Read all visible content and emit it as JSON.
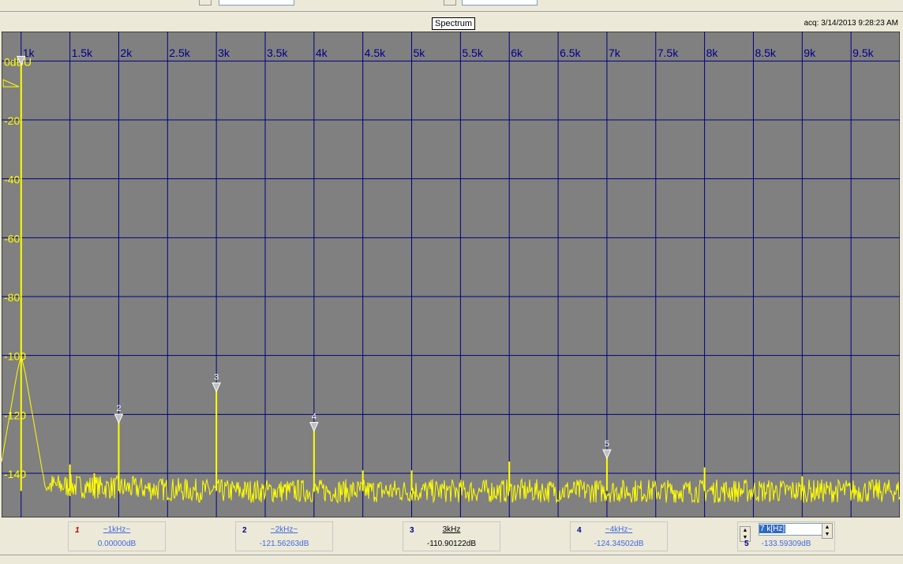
{
  "header": {
    "title": "Spectrum",
    "acq": "acq: 3/14/2013 9:28:23 AM"
  },
  "chart_data": {
    "type": "line",
    "title": "Spectrum",
    "xlabel": "",
    "ylabel": "",
    "xlim": [
      800,
      10000
    ],
    "ylim": [
      -155,
      10
    ],
    "x_ticks": [
      {
        "value": 1000,
        "label": "1k"
      },
      {
        "value": 1500,
        "label": "1.5k"
      },
      {
        "value": 2000,
        "label": "2k"
      },
      {
        "value": 2500,
        "label": "2.5k"
      },
      {
        "value": 3000,
        "label": "3k"
      },
      {
        "value": 3500,
        "label": "3.5k"
      },
      {
        "value": 4000,
        "label": "4k"
      },
      {
        "value": 4500,
        "label": "4.5k"
      },
      {
        "value": 5000,
        "label": "5k"
      },
      {
        "value": 5500,
        "label": "5.5k"
      },
      {
        "value": 6000,
        "label": "6k"
      },
      {
        "value": 6500,
        "label": "6.5k"
      },
      {
        "value": 7000,
        "label": "7k"
      },
      {
        "value": 7500,
        "label": "7.5k"
      },
      {
        "value": 8000,
        "label": "8k"
      },
      {
        "value": 8500,
        "label": "8.5k"
      },
      {
        "value": 9000,
        "label": "9k"
      },
      {
        "value": 9500,
        "label": "9.5k"
      }
    ],
    "y_ticks": [
      {
        "value": 0,
        "label": "0dBU"
      },
      {
        "value": -20,
        "label": "-20"
      },
      {
        "value": -40,
        "label": "-40"
      },
      {
        "value": -60,
        "label": "-60"
      },
      {
        "value": -80,
        "label": "-80"
      },
      {
        "value": -100,
        "label": "-100"
      },
      {
        "value": -120,
        "label": "-120"
      },
      {
        "value": -140,
        "label": "-140"
      }
    ],
    "grid": true,
    "noise_floor_db": -146,
    "series": [
      {
        "color": "#ffff00",
        "peaks": [
          {
            "x": 1000,
            "y": 0
          },
          {
            "x": 1500,
            "y": -137
          },
          {
            "x": 1750,
            "y": -140
          },
          {
            "x": 2000,
            "y": -121.6
          },
          {
            "x": 3000,
            "y": -110.9
          },
          {
            "x": 4000,
            "y": -124.3
          },
          {
            "x": 4500,
            "y": -139
          },
          {
            "x": 5000,
            "y": -139
          },
          {
            "x": 6000,
            "y": -136
          },
          {
            "x": 7000,
            "y": -133.6
          },
          {
            "x": 8000,
            "y": -138
          },
          {
            "x": 9000,
            "y": -141
          }
        ]
      }
    ],
    "markers": [
      {
        "num": "1",
        "x": 1000,
        "y": 0,
        "freq_label": "~1kHz~",
        "value_label": "0.00000dB",
        "active": false
      },
      {
        "num": "2",
        "x": 2000,
        "y": -121.56263,
        "freq_label": "~2kHz~",
        "value_label": "-121.56263dB",
        "active": false
      },
      {
        "num": "3",
        "x": 3000,
        "y": -110.90122,
        "freq_label": "3kHz",
        "value_label": "-110.90122dB",
        "active": true
      },
      {
        "num": "4",
        "x": 4000,
        "y": -124.34502,
        "freq_label": "~4kHz~",
        "value_label": "-124.34502dB",
        "active": false
      },
      {
        "num": "5",
        "x": 7000,
        "y": -133.59309,
        "freq_label": "7 k[Hz]",
        "value_label": "-133.59309dB",
        "active": false
      }
    ],
    "colors": {
      "background": "#808080",
      "grid": "#00007f",
      "axis_text": "#00008b",
      "y_text": "#ffff00",
      "trace": "#ffff00"
    }
  }
}
